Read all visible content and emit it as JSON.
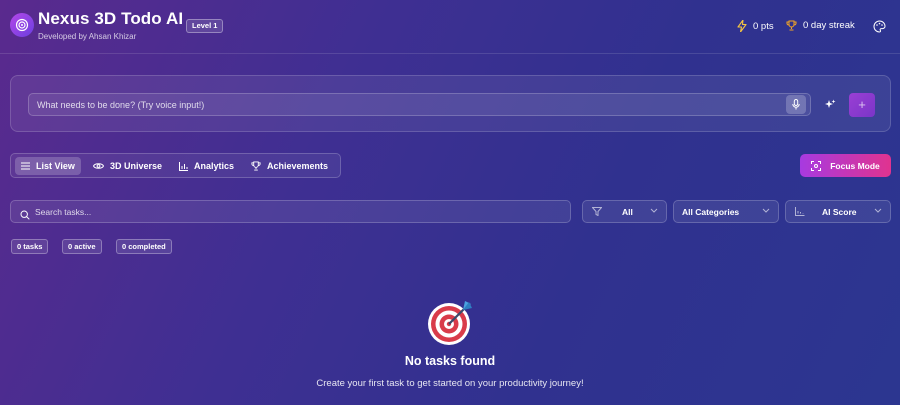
{
  "header": {
    "title": "Nexus 3D Todo AI",
    "subtitle": "Developed by Ahsan Khizar",
    "level": "Level 1",
    "points": "0 pts",
    "streak": "0 day streak"
  },
  "task_input": {
    "placeholder": "What needs to be done? (Try voice input!)",
    "add_label": "+"
  },
  "view_tabs": [
    {
      "label": "List View",
      "icon": "list-icon",
      "active": true
    },
    {
      "label": "3D Universe",
      "icon": "eye-icon"
    },
    {
      "label": "Analytics",
      "icon": "bar-chart-icon"
    },
    {
      "label": "Achievements",
      "icon": "trophy-icon"
    }
  ],
  "focus_mode": {
    "label": "Focus Mode",
    "icon": "focus-icon"
  },
  "search": {
    "placeholder": "Search tasks..."
  },
  "filters": {
    "status": "All",
    "category": "All Categories",
    "sort": "AI Score"
  },
  "counts": {
    "tasks": "0 tasks",
    "active": "0 active",
    "completed": "0 completed"
  },
  "empty_state": {
    "title": "No tasks found",
    "message": "Create your first task to get started on your productivity journey!"
  },
  "colors": {
    "accent_purple": "#a73ae0",
    "accent_pink": "#e0338f",
    "points_icon": "#f5c542"
  }
}
